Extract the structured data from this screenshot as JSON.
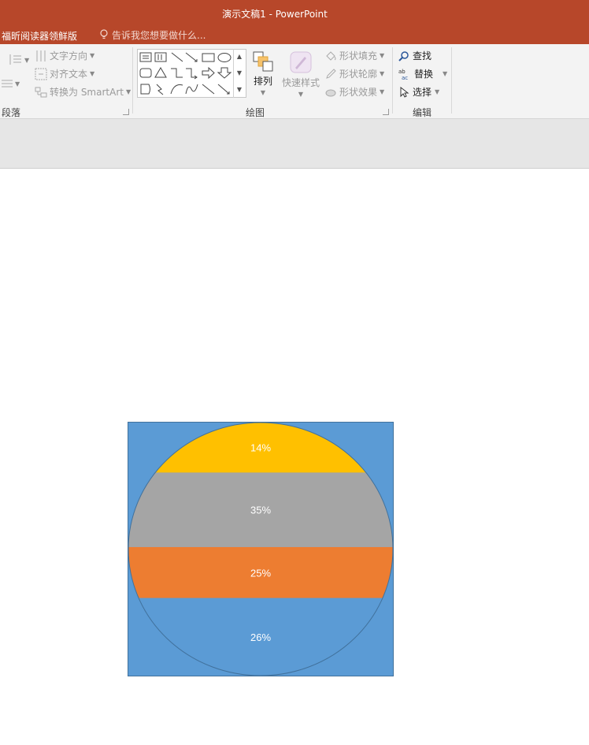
{
  "window": {
    "title": "演示文稿1 - PowerPoint"
  },
  "tabs": {
    "foxit": "福昕阅读器领鲜版",
    "tell_me_placeholder": "告诉我您想要做什么..."
  },
  "ribbon": {
    "paragraph": {
      "label": "段落",
      "text_direction": "文字方向",
      "align_text": "对齐文本",
      "convert_smartart": "转换为 SmartArt"
    },
    "drawing": {
      "label": "绘图",
      "arrange": "排列",
      "quick_styles": "快速样式",
      "shape_fill": "形状填充",
      "shape_outline": "形状轮廓",
      "shape_effects": "形状效果"
    },
    "editing": {
      "label": "编辑",
      "find": "查找",
      "replace": "替换",
      "select": "选择"
    }
  },
  "chart_data": {
    "type": "pie",
    "slices": [
      {
        "label": "14%",
        "value": 14,
        "color": "#ffc000"
      },
      {
        "label": "35%",
        "value": 35,
        "color": "#a5a5a5"
      },
      {
        "label": "25%",
        "value": 25,
        "color": "#ed7d31"
      },
      {
        "label": "26%",
        "value": 26,
        "color": "#5b9bd5"
      }
    ],
    "background_color": "#5b9bd5",
    "title": "",
    "legend": "none"
  },
  "colors": {
    "title_bar": "#b7472a",
    "ribbon": "#f3f3f3"
  }
}
